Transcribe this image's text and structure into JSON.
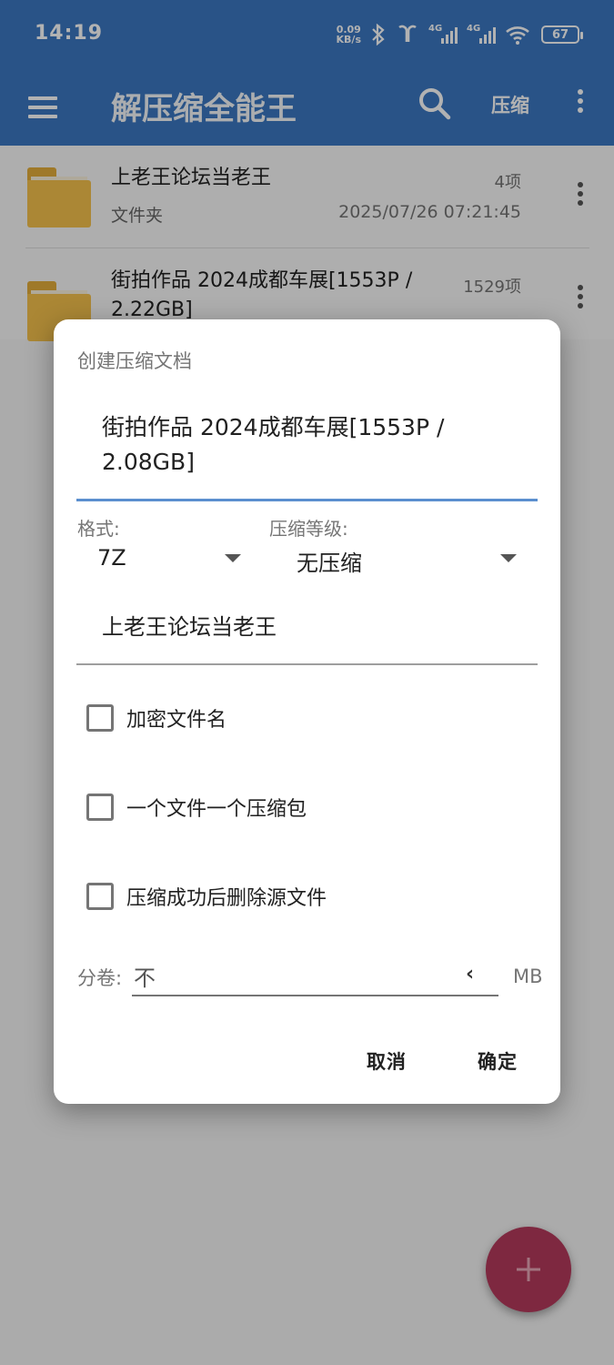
{
  "status_bar": {
    "time": "14:19",
    "net_speed_value": "0.09",
    "net_speed_unit": "KB/s",
    "signal_1": "4G",
    "signal_2": "4G",
    "battery": "67"
  },
  "app_bar": {
    "title": "解压缩全能王",
    "compress_label": "压缩",
    "color": "#3b78c2"
  },
  "files": [
    {
      "name": "上老王论坛当老王",
      "type": "文件夹",
      "count": "4项",
      "date": "2025/07/26 07:21:45"
    },
    {
      "name": "街拍作品  2024成都车展[1553P / 2.22GB]",
      "count": "1529项"
    }
  ],
  "dialog": {
    "title": "创建压缩文档",
    "archive_name": "街拍作品  2024成都车展[1553P / 2.08GB]",
    "format_label": "格式:",
    "format_value": "7Z",
    "level_label": "压缩等级:",
    "level_value": "无压缩",
    "path_value": "上老王论坛当老王",
    "options": [
      {
        "label": "加密文件名",
        "checked": false
      },
      {
        "label": "一个文件一个压缩包",
        "checked": false
      },
      {
        "label": "压缩成功后删除源文件",
        "checked": false
      }
    ],
    "split_label": "分卷:",
    "split_value": "不",
    "split_unit": "MB",
    "cancel_label": "取消",
    "confirm_label": "确定",
    "accent_color": "#5b8fcf"
  },
  "fab": {
    "color": "#b53a5c",
    "icon": "plus-icon"
  }
}
